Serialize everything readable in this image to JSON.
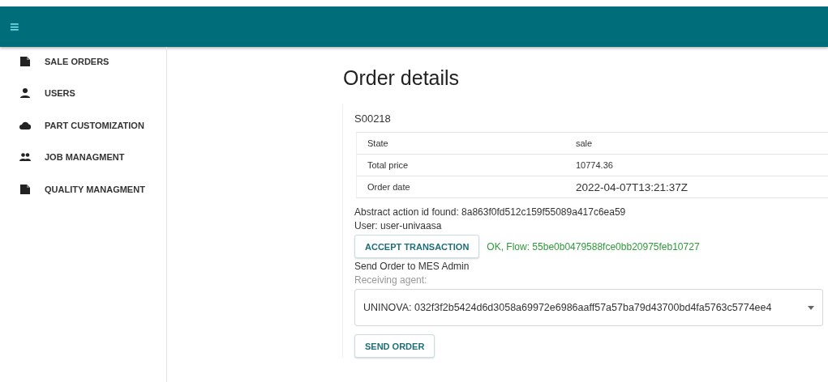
{
  "header": {
    "menu_icon": "≡"
  },
  "sidebar": {
    "items": [
      {
        "label": "SALE ORDERS",
        "kind": "document"
      },
      {
        "label": "USERS",
        "kind": "person"
      },
      {
        "label": "PART CUSTOMIZATION",
        "kind": "cloud"
      },
      {
        "label": "JOB MANAGMENT",
        "kind": "group"
      },
      {
        "label": "QUALITY MANAGMENT",
        "kind": "document"
      }
    ]
  },
  "page": {
    "title": "Order details"
  },
  "order": {
    "id": "S00218",
    "details": [
      {
        "label": "State",
        "value": "sale"
      },
      {
        "label": "Total price",
        "value": "10774.36"
      },
      {
        "label": "Order date",
        "value": "2022-04-07T13:21:37Z"
      }
    ],
    "action_text": "Abstract action id found: 8a863f0fd512c159f55089a417c6ea59",
    "user_text": "User: user-univaasa",
    "accept_button": "ACCEPT TRANSACTION",
    "flow_status": "OK, Flow: 55be0b0479588fce0bb20975feb10727",
    "send_heading": "Send Order to MES Admin",
    "agent_select": {
      "label": "Receiving agent:",
      "value": "UNINOVA: 032f3f2b5424d6d3058a69972e6986aaff57a57ba79d43700bd4fa5763c5774ee4"
    },
    "send_button": "SEND ORDER"
  }
}
